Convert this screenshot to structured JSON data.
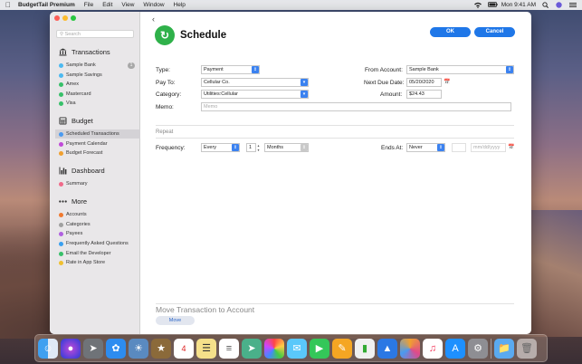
{
  "menubar": {
    "app_name": "BudgetTail Premium",
    "menus": [
      "File",
      "Edit",
      "View",
      "Window",
      "Help"
    ],
    "clock": "Mon 9:41 AM"
  },
  "sidebar": {
    "search_placeholder": "Search",
    "transactions": {
      "title": "Transactions",
      "items": [
        {
          "label": "Sample Bank",
          "color": "#4cb9f0",
          "badge": "1"
        },
        {
          "label": "Sample Savings",
          "color": "#4cb9f0"
        },
        {
          "label": "Amex",
          "color": "#38c06a"
        },
        {
          "label": "Mastercard",
          "color": "#38c06a"
        },
        {
          "label": "Visa",
          "color": "#38c06a"
        }
      ]
    },
    "budget": {
      "title": "Budget",
      "items": [
        {
          "label": "Scheduled Transactions",
          "color": "#4a9af0"
        },
        {
          "label": "Payment Calendar",
          "color": "#c04ad8"
        },
        {
          "label": "Budget Forecast",
          "color": "#f0a030"
        }
      ]
    },
    "dashboard": {
      "title": "Dashboard",
      "items": [
        {
          "label": "Summary",
          "color": "#f06a8a"
        }
      ]
    },
    "more": {
      "title": "More",
      "items": [
        {
          "label": "Accounts",
          "color": "#f07a30"
        },
        {
          "label": "Categories",
          "color": "#a0a0a0"
        },
        {
          "label": "Payees",
          "color": "#b060e0"
        },
        {
          "label": "Frequently Asked Questions",
          "color": "#3aa0f0"
        },
        {
          "label": "Email the Developer",
          "color": "#38c06a"
        },
        {
          "label": "Rate in App Store",
          "color": "#f0c030"
        }
      ]
    }
  },
  "main": {
    "title": "Schedule",
    "ok_label": "OK",
    "cancel_label": "Cancel",
    "type_label": "Type:",
    "type_value": "Payment",
    "pay_to_label": "Pay To:",
    "pay_to_value": "Cellular Co.",
    "category_label": "Category:",
    "category_value": "Utilities:Cellular",
    "memo_label": "Memo:",
    "memo_placeholder": "Memo",
    "from_account_label": "From Account:",
    "from_account_value": "Sample Bank",
    "next_due_label": "Next Due Date:",
    "next_due_value": "05/20/2020",
    "amount_label": "Amount:",
    "amount_value": "$24.43",
    "repeat_label": "Repeat",
    "frequency_label": "Frequency:",
    "frequency_value": "Every",
    "interval_value": "1",
    "unit_value": "Months",
    "ends_at_label": "Ends At:",
    "ends_at_value": "Never",
    "end_date_placeholder": "mm/dd/yyyy",
    "move_title": "Move Transaction to Account",
    "move_label": "Move"
  },
  "colors": {
    "accent": "#1f77e8",
    "logo": "#2fb14a"
  }
}
